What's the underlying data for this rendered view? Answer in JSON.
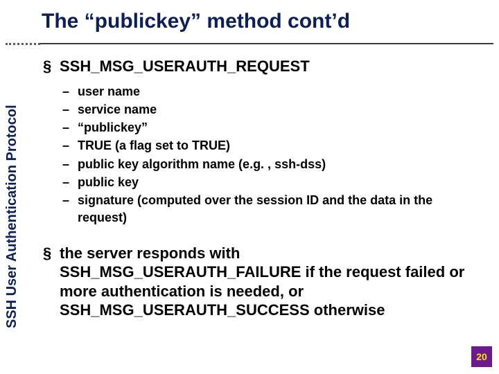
{
  "title": "The “publickey” method cont’d",
  "sidebar_label": "SSH User Authentication Protocol",
  "bullets": {
    "top1": "SSH_MSG_USERAUTH_REQUEST",
    "sub": [
      "user name",
      "service name",
      "“publickey”",
      "TRUE (a flag set to TRUE)",
      "public key algorithm name (e.g. , ssh-dss)",
      "public key",
      "signature (computed over the session ID and the data in the request)"
    ],
    "top2": "the server responds with SSH_MSG_USERAUTH_FAILURE if the request failed or more authentication is needed, or SSH_MSG_USERAUTH_SUCCESS otherwise"
  },
  "page_number": "20"
}
